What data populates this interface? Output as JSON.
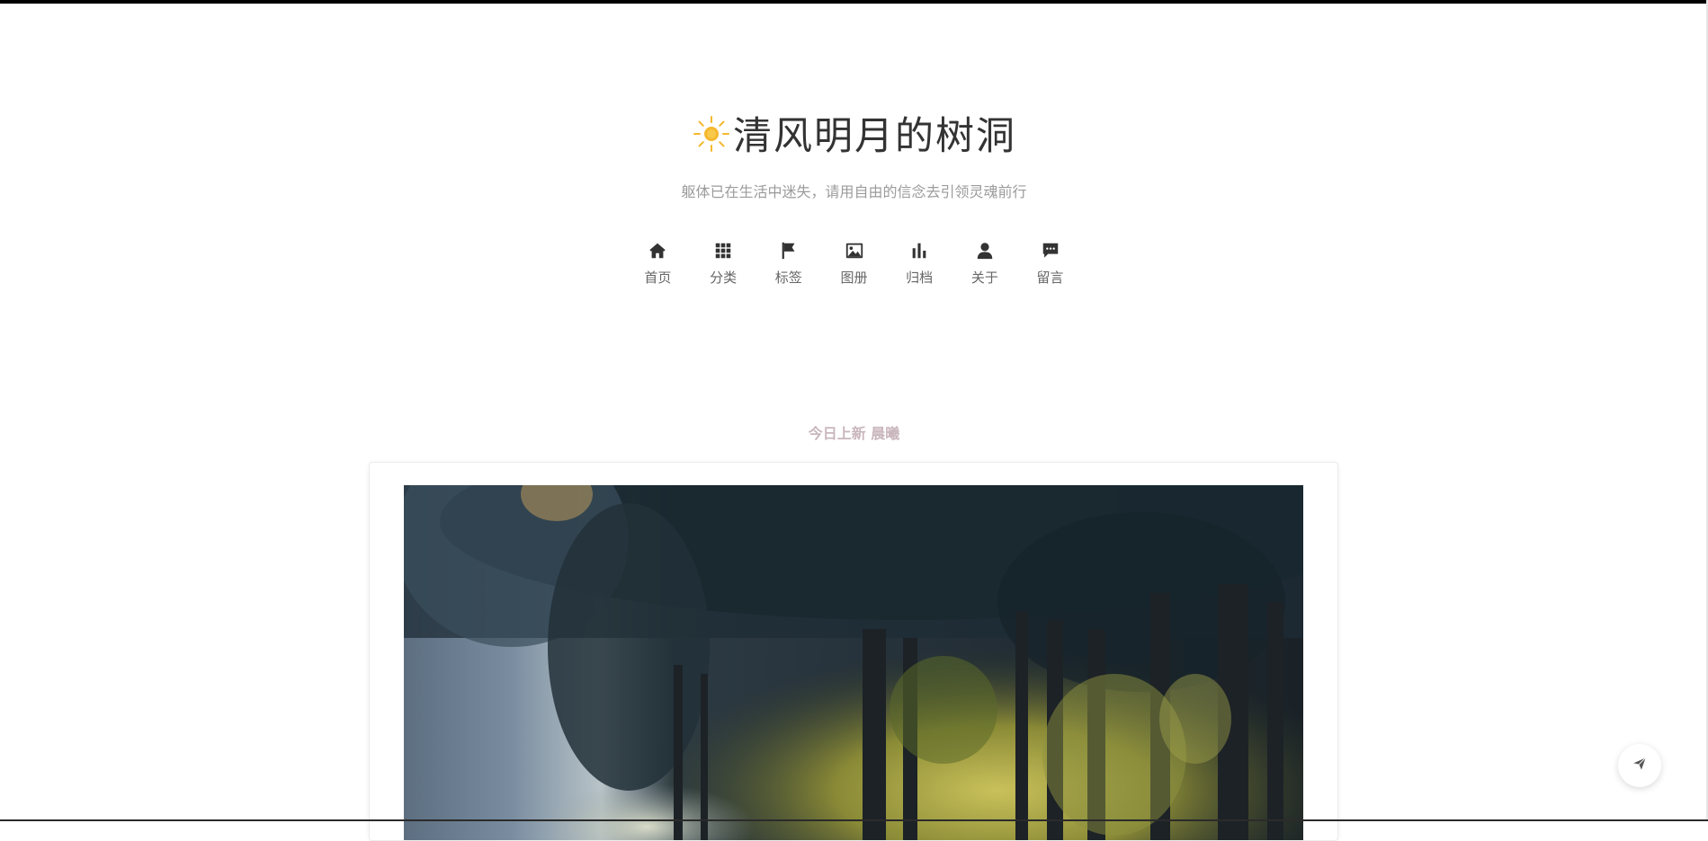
{
  "site": {
    "title": "清风明月的树洞",
    "subtitle": "躯体已在生活中迷失，请用自由的信念去引领灵魂前行",
    "icon": "sun-icon"
  },
  "nav": {
    "items": [
      {
        "label": "首页",
        "icon": "home-icon"
      },
      {
        "label": "分类",
        "icon": "grid-icon"
      },
      {
        "label": "标签",
        "icon": "flag-icon"
      },
      {
        "label": "图册",
        "icon": "image-icon"
      },
      {
        "label": "归档",
        "icon": "bar-chart-icon"
      },
      {
        "label": "关于",
        "icon": "user-icon"
      },
      {
        "label": "留言",
        "icon": "message-icon"
      }
    ]
  },
  "today": {
    "label": "今日上新 晨曦"
  },
  "post": {
    "cover_icon": "forest-road-photo"
  },
  "float_action": {
    "icon": "paper-plane-icon"
  },
  "colors": {
    "title": "#333333",
    "subtitle": "#9b9b9b",
    "nav_icon": "#333333",
    "nav_label": "#666666",
    "today_label": "#c9b6bd",
    "sun": "#f5b82e"
  }
}
